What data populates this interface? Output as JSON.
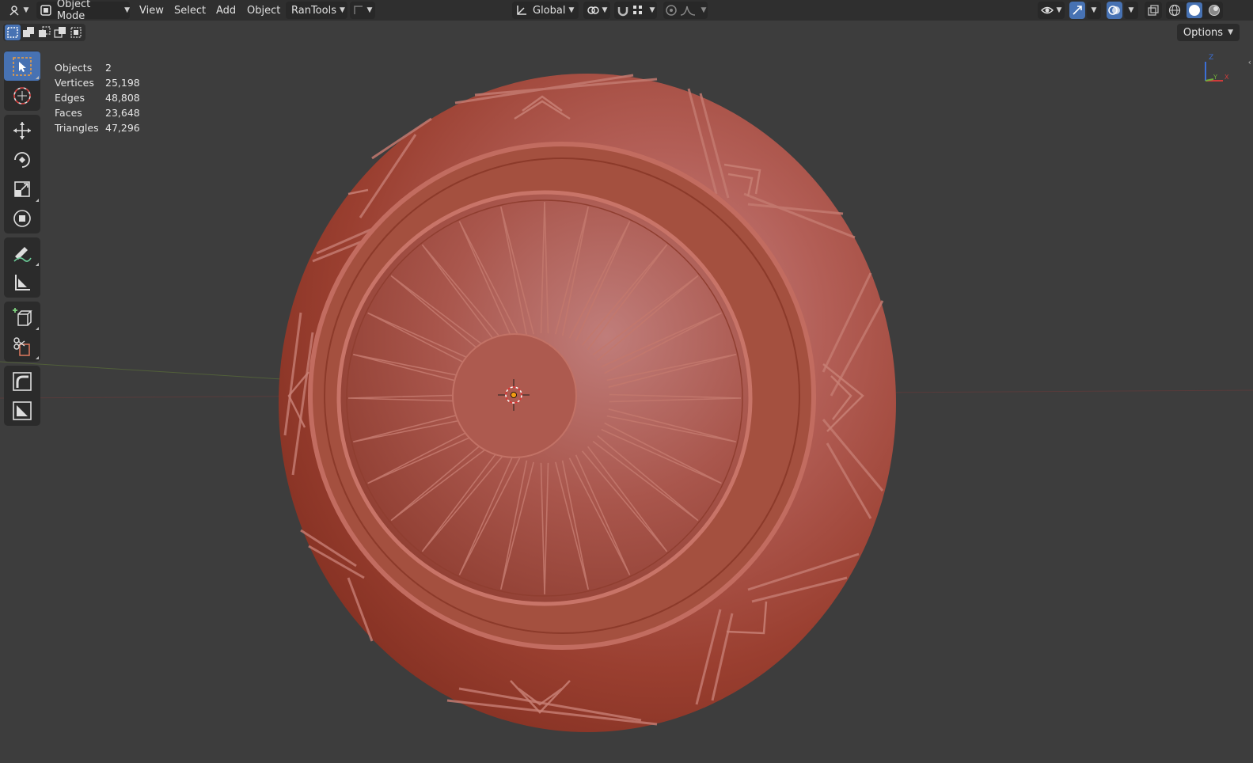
{
  "header": {
    "editor_type_icon": "3d-viewport-icon",
    "mode_label": "Object Mode",
    "menus": [
      "View",
      "Select",
      "Add",
      "Object"
    ],
    "addon_menu": "RanTools",
    "transform_orientation": "Global",
    "accent_color": "#4772b3"
  },
  "toolbar_row": {
    "select_modes": [
      "select-new-icon",
      "select-extend-icon",
      "select-subtract-icon",
      "select-intersect-icon",
      "select-invert-icon"
    ],
    "options_label": "Options"
  },
  "tools": [
    {
      "name": "select-box",
      "icon": "select-box-icon"
    },
    {
      "name": "cursor",
      "icon": "cursor-icon"
    },
    {
      "name": "move",
      "icon": "move-icon"
    },
    {
      "name": "rotate",
      "icon": "rotate-icon"
    },
    {
      "name": "scale",
      "icon": "scale-icon"
    },
    {
      "name": "transform",
      "icon": "transform-icon"
    },
    {
      "name": "annotate",
      "icon": "annotate-icon"
    },
    {
      "name": "measure",
      "icon": "measure-icon"
    },
    {
      "name": "add-cube",
      "icon": "add-cube-icon"
    },
    {
      "name": "cut",
      "icon": "cut-icon"
    },
    {
      "name": "tool-a",
      "icon": "curve-tool-icon"
    },
    {
      "name": "tool-b",
      "icon": "bevel-tool-icon"
    }
  ],
  "stats": {
    "objects": {
      "label": "Objects",
      "value": "2"
    },
    "vertices": {
      "label": "Vertices",
      "value": "25,198"
    },
    "edges": {
      "label": "Edges",
      "value": "48,808"
    },
    "faces": {
      "label": "Faces",
      "value": "23,648"
    },
    "triangles": {
      "label": "Triangles",
      "value": "47,296"
    }
  },
  "gizmo": {
    "z": "Z",
    "y": "Y",
    "x": "X"
  },
  "model": {
    "base_color": "#a94a3c"
  }
}
